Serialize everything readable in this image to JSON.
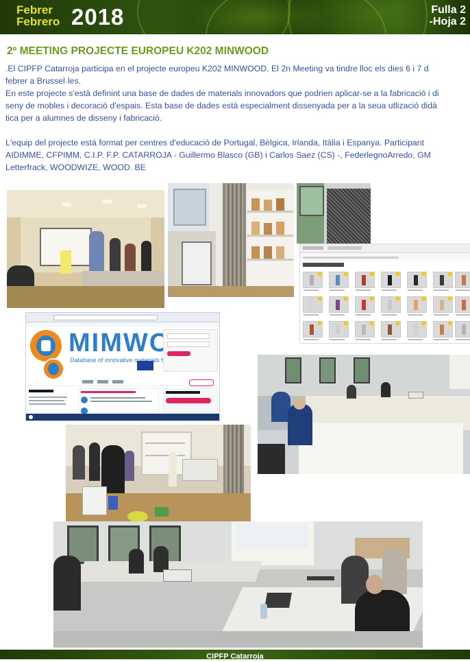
{
  "header": {
    "month_ca": "Febrer",
    "month_es": "Febrero",
    "year": "2018",
    "sheet_ca": "Fulla 2",
    "sheet_es": "-Hoja 2"
  },
  "article": {
    "title": "2º MEETING PROJECTE EUROPEU K202 MINWOOD",
    "lines": [
      ".El CIPFP Catarroja participa en el projecte europeu K202 MINWOOD. El 2n Meeting va tindre lloc els dies 6 i 7 d",
      "febrer a Brussel·les.",
      "En este projecte s'està definint una base de dades de materials innovadors que podrien aplicar-se a la fabricació i di",
      "seny de mobles i decoració d'espais. Esta base de dades està especialment dissenyada per a la seua utlizació didà",
      "tica per a alumnes de disseny i fabricació.",
      "",
      "L'equip del projecte està format per centres d'educació de Portugal, Bèlgica, Irlanda, Itàlia i Espanya. Participant",
      "AIDIMME, CFPIMM, C.I.P. F.P. CATARROJA - Guillermo Blasco (GB) i Carlos Saez (CS) -, FederlegnoArredo, GM",
      "Letterfrack, WOODWIZE, WOOD. BE"
    ]
  },
  "screenshot_browser": {
    "logo_text": "MIMWO",
    "tagline": "Database of innovative materials for the f"
  },
  "footer": {
    "school": "CIPFP Catarroja"
  },
  "colors": {
    "accent_yellow": "#e8e21a",
    "title_green": "#6a9c1a",
    "body_blue": "#3050a0",
    "header_dark_green": "#2f5410",
    "mimwo_orange": "#f08a1c",
    "mimwo_blue": "#2e7fc8"
  }
}
